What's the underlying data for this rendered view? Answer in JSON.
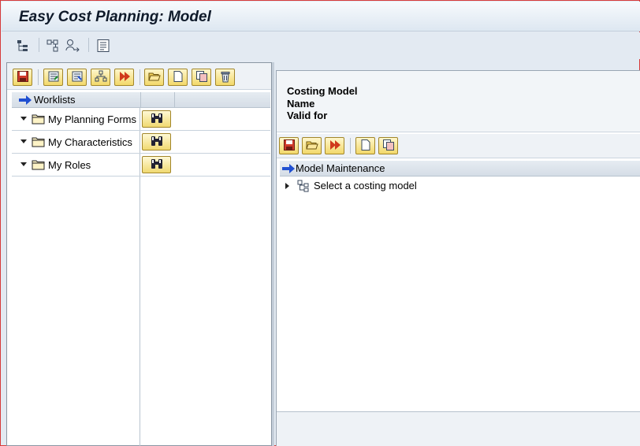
{
  "window": {
    "title": "Easy Cost Planning: Model"
  },
  "app_toolbar": {
    "icons": [
      "hierarchy-tree-icon",
      "structure-icon",
      "user-goto-icon",
      "list-icon"
    ]
  },
  "left_pane": {
    "toolbar_icons": [
      "save-icon",
      "export-icon",
      "import-icon",
      "add-node-icon",
      "execute-icon",
      "open-folder-icon",
      "new-document-icon",
      "copy-icon",
      "delete-icon"
    ],
    "header": "Worklists",
    "rows": [
      {
        "label": "My Planning Forms"
      },
      {
        "label": "My Characteristics"
      },
      {
        "label": "My Roles"
      }
    ]
  },
  "right_pane": {
    "header_lines": {
      "line1": "Costing Model",
      "line2": "Name",
      "line3": "Valid for"
    },
    "toolbar_icons": [
      "save-icon",
      "open-folder-icon",
      "execute-icon",
      "new-document-icon",
      "copy-icon"
    ],
    "tree_header": "Model Maintenance",
    "tree_item": "Select a costing model"
  },
  "colors": {
    "frame_border": "#d63a3a",
    "button_yellow": "#f2d86a",
    "arrow_blue": "#1f4fd1"
  }
}
